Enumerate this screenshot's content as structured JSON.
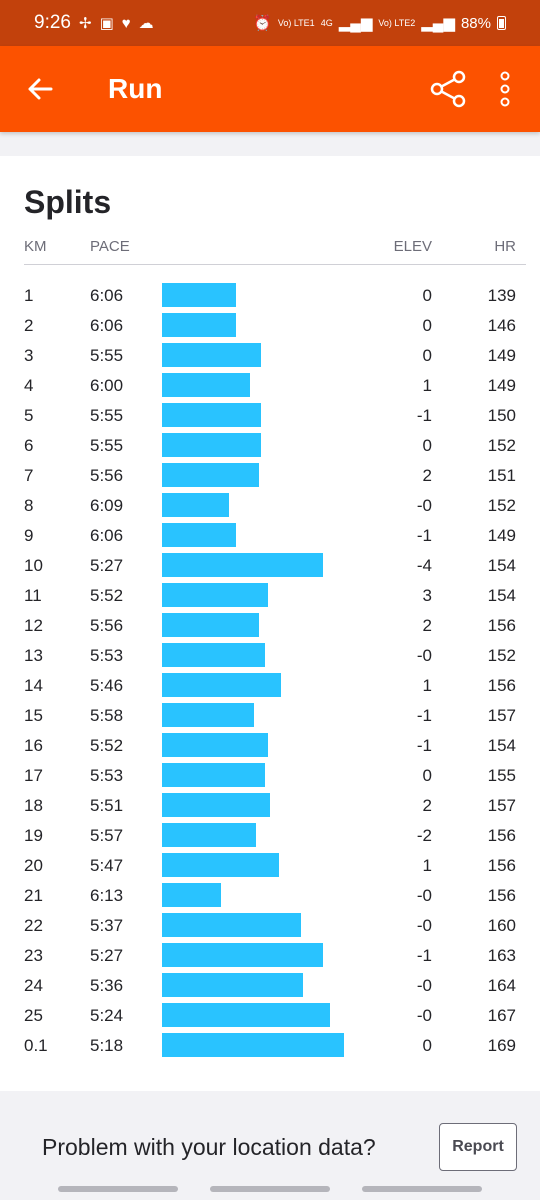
{
  "status": {
    "time": "9:26",
    "network1": "Vo) LTE1",
    "network_type": "4G",
    "network2": "Vo) LTE2",
    "battery": "88%"
  },
  "app_bar": {
    "title": "Run"
  },
  "splits": {
    "title": "Splits",
    "headers": {
      "km": "KM",
      "pace": "PACE",
      "elev": "ELEV",
      "hr": "HR"
    },
    "rows": [
      {
        "km": "1",
        "pace": "6:06",
        "elev": "0",
        "hr": "139"
      },
      {
        "km": "2",
        "pace": "6:06",
        "elev": "0",
        "hr": "146"
      },
      {
        "km": "3",
        "pace": "5:55",
        "elev": "0",
        "hr": "149"
      },
      {
        "km": "4",
        "pace": "6:00",
        "elev": "1",
        "hr": "149"
      },
      {
        "km": "5",
        "pace": "5:55",
        "elev": "-1",
        "hr": "150"
      },
      {
        "km": "6",
        "pace": "5:55",
        "elev": "0",
        "hr": "152"
      },
      {
        "km": "7",
        "pace": "5:56",
        "elev": "2",
        "hr": "151"
      },
      {
        "km": "8",
        "pace": "6:09",
        "elev": "-0",
        "hr": "152"
      },
      {
        "km": "9",
        "pace": "6:06",
        "elev": "-1",
        "hr": "149"
      },
      {
        "km": "10",
        "pace": "5:27",
        "elev": "-4",
        "hr": "154"
      },
      {
        "km": "11",
        "pace": "5:52",
        "elev": "3",
        "hr": "154"
      },
      {
        "km": "12",
        "pace": "5:56",
        "elev": "2",
        "hr": "156"
      },
      {
        "km": "13",
        "pace": "5:53",
        "elev": "-0",
        "hr": "152"
      },
      {
        "km": "14",
        "pace": "5:46",
        "elev": "1",
        "hr": "156"
      },
      {
        "km": "15",
        "pace": "5:58",
        "elev": "-1",
        "hr": "157"
      },
      {
        "km": "16",
        "pace": "5:52",
        "elev": "-1",
        "hr": "154"
      },
      {
        "km": "17",
        "pace": "5:53",
        "elev": "0",
        "hr": "155"
      },
      {
        "km": "18",
        "pace": "5:51",
        "elev": "2",
        "hr": "157"
      },
      {
        "km": "19",
        "pace": "5:57",
        "elev": "-2",
        "hr": "156"
      },
      {
        "km": "20",
        "pace": "5:47",
        "elev": "1",
        "hr": "156"
      },
      {
        "km": "21",
        "pace": "6:13",
        "elev": "-0",
        "hr": "156"
      },
      {
        "km": "22",
        "pace": "5:37",
        "elev": "-0",
        "hr": "160"
      },
      {
        "km": "23",
        "pace": "5:27",
        "elev": "-1",
        "hr": "163"
      },
      {
        "km": "24",
        "pace": "5:36",
        "elev": "-0",
        "hr": "164"
      },
      {
        "km": "25",
        "pace": "5:24",
        "elev": "-0",
        "hr": "167"
      },
      {
        "km": "0.1",
        "pace": "5:18",
        "elev": "0",
        "hr": "169"
      }
    ]
  },
  "footer": {
    "question": "Problem with your location data?",
    "report_label": "Report"
  },
  "colors": {
    "accent": "#fc5200",
    "status_bar": "#c2410c",
    "pace_bar": "#29c3ff"
  }
}
